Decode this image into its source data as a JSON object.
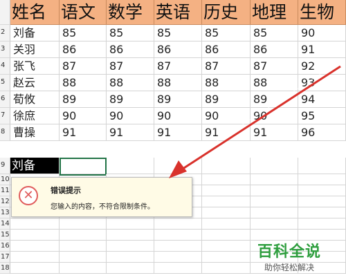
{
  "row_numbers": [
    "2",
    "3",
    "4",
    "5",
    "6",
    "7",
    "8",
    "9",
    "10",
    "11",
    "12",
    "13",
    "14",
    "15",
    "16",
    "17",
    "18"
  ],
  "table": {
    "headers": [
      "姓名",
      "语文",
      "数学",
      "英语",
      "历史",
      "地理",
      "生物"
    ],
    "rows": [
      [
        "刘备",
        "85",
        "85",
        "85",
        "85",
        "85",
        "90"
      ],
      [
        "关羽",
        "86",
        "86",
        "86",
        "86",
        "86",
        "91"
      ],
      [
        "张飞",
        "87",
        "87",
        "87",
        "87",
        "87",
        "92"
      ],
      [
        "赵云",
        "88",
        "88",
        "88",
        "88",
        "88",
        "93"
      ],
      [
        "荀攸",
        "89",
        "89",
        "89",
        "89",
        "89",
        "94"
      ],
      [
        "徐庶",
        "90",
        "90",
        "90",
        "90",
        "90",
        "95"
      ],
      [
        "曹操",
        "91",
        "91",
        "91",
        "91",
        "91",
        "96"
      ]
    ],
    "entry_cell": "刘备"
  },
  "error_tip": {
    "title": "错误提示",
    "message": "您输入的内容，不符合限制条件。",
    "icon": "error-x-icon"
  },
  "watermark": {
    "title": "百科全说",
    "subtitle": "助你轻松解决"
  },
  "colors": {
    "header_fill": "#f4b183",
    "arrow": "#d9322c",
    "selection_border": "#217346",
    "watermark_green": "#2e9e3e"
  }
}
